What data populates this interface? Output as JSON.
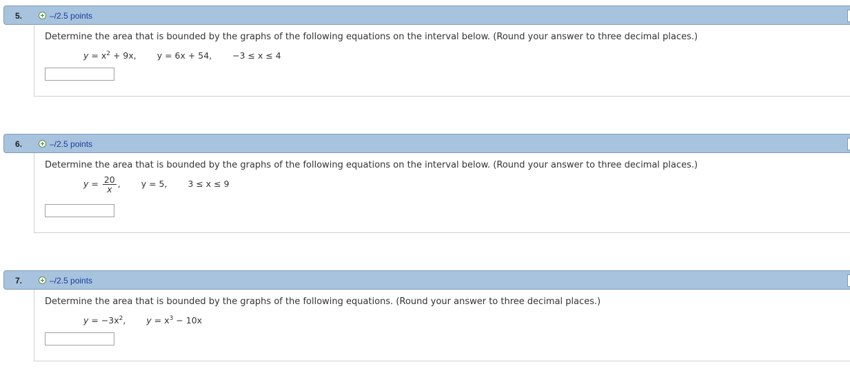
{
  "questions": [
    {
      "number": "5.",
      "points": "–/2.5 points",
      "prompt": "Determine the area that is bounded by the graphs of the following equations on the interval below. (Round your answer to three decimal places.)",
      "eq1_lhs": "y",
      "eq1_rhs": "= x",
      "eq1_exp": "2",
      "eq1_tail": " + 9x,",
      "eq2": "y = 6x + 54,",
      "interval": "−3 ≤ x ≤ 4",
      "answer": ""
    },
    {
      "number": "6.",
      "points": "–/2.5 points",
      "prompt": "Determine the area that is bounded by the graphs of the following equations on the interval below. (Round your answer to three decimal places.)",
      "eq1_lhs": "y",
      "eq1_eq": "=",
      "frac_num": "20",
      "frac_den": "x",
      "eq1_tail": ",",
      "eq2": "y = 5,",
      "interval": "3 ≤ x ≤ 9",
      "answer": ""
    },
    {
      "number": "7.",
      "points": "–/2.5 points",
      "prompt": "Determine the area that is bounded by the graphs of the following equations. (Round your answer to three decimal places.)",
      "eq1_lhs": "y",
      "eq1_rhs": "= −3x",
      "eq1_exp": "2",
      "eq1_tail": ",",
      "eq2_lhs": "y",
      "eq2_rhs": "= x",
      "eq2_exp": "3",
      "eq2_tail": " − 10x",
      "answer": ""
    }
  ]
}
